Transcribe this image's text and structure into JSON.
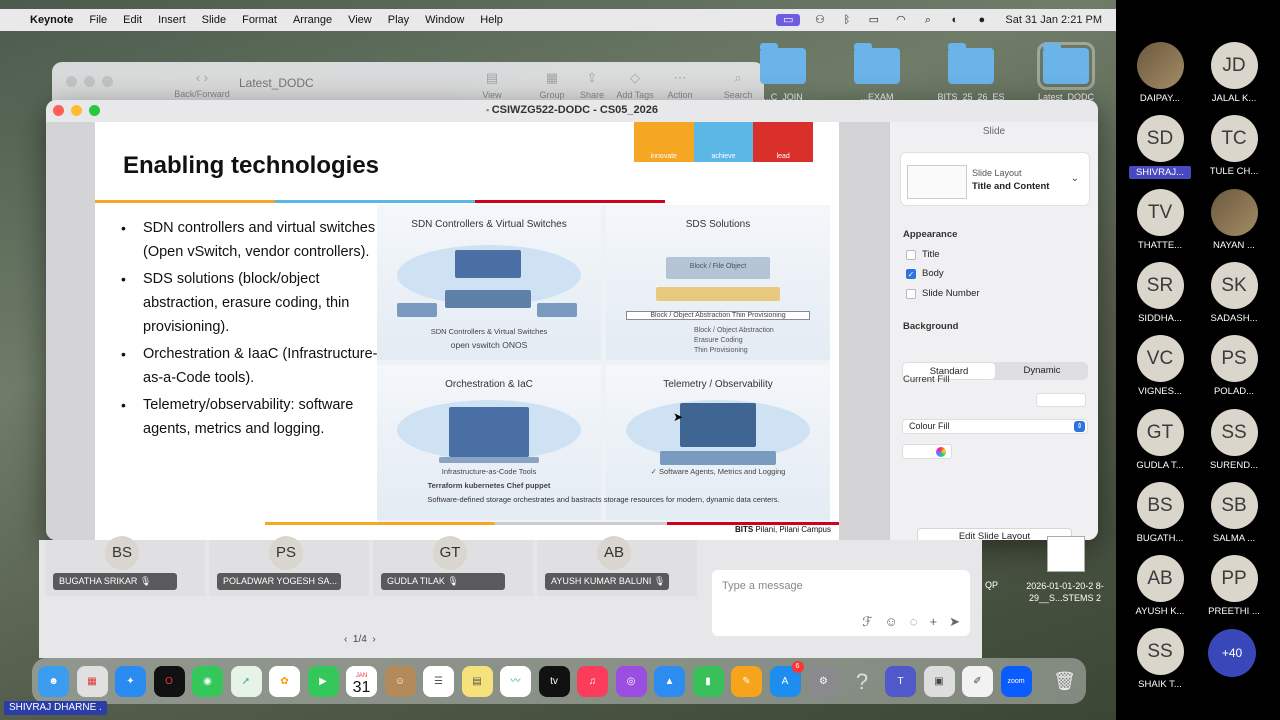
{
  "menubar": {
    "app": "Keynote",
    "items": [
      "File",
      "Edit",
      "Insert",
      "Slide",
      "Format",
      "Arrange",
      "View",
      "Play",
      "Window",
      "Help"
    ],
    "datetime": "Sat 31 Jan  2:21 PM"
  },
  "bg_finder": {
    "title": "Latest_DODC",
    "back_forward": "Back/Forward",
    "tools": [
      "View",
      "Group",
      "Share",
      "Add Tags",
      "Action",
      "Search"
    ]
  },
  "desktop_folders": [
    {
      "label": "...C_JOIN"
    },
    {
      "label": "...EXAM"
    },
    {
      "label": "BITS_25_26_ES"
    },
    {
      "label": "Latest_DODC"
    }
  ],
  "keynote": {
    "window_title": "CSIWZG522-DODC - CS05_2026",
    "slide": {
      "title": "Enabling technologies",
      "brand": [
        "innovate",
        "achieve",
        "lead"
      ],
      "bullets": [
        "SDN controllers and virtual switches (Open vSwitch, vendor controllers).",
        "SDS solutions (block/object abstraction, erasure coding, thin provisioning).",
        "Orchestration & IaaC (Infrastructure-as-a-Code tools).",
        "Telemetry/observability: software agents, metrics and logging."
      ],
      "infographic": {
        "q1": {
          "title": "SDN Controllers & Virtual Switches",
          "caption": "SDN Controllers & Virtual Switches",
          "logos": "open vswitch  ONOS"
        },
        "q2": {
          "title": "SDS Solutions",
          "top": "Block / File  Object",
          "bar": "Block / Object Abstraction   Thin Provisioning",
          "items": [
            "Block / Object Abstraction",
            "Erasure Coding",
            "Thin Provisioning"
          ]
        },
        "q3": {
          "title": "Orchestration & IaC",
          "caption": "Infrastructure-as-Code Tools",
          "logos": "Terraform   kubernetes   Chef   puppet"
        },
        "q4": {
          "title": "Telemetry / Observability",
          "caption": "✓ Software Agents, Metrics and Logging"
        },
        "footer": "Software-defined storage orchestrates and bastracts storage resources for modern, dynamic data centers."
      },
      "campus_bold": "BITS",
      "campus_rest": " Pilani, Pilani Campus"
    },
    "inspector": {
      "tab": "Slide",
      "layout_label": "Slide Layout",
      "layout_name": "Title and Content",
      "appearance": "Appearance",
      "checks": [
        {
          "label": "Title",
          "checked": false
        },
        {
          "label": "Body",
          "checked": true
        },
        {
          "label": "Slide Number",
          "checked": false
        }
      ],
      "background": "Background",
      "seg": [
        "Standard",
        "Dynamic"
      ],
      "current_fill": "Current Fill",
      "fill_type": "Colour Fill",
      "edit_layout": "Edit Slide Layout"
    }
  },
  "zoom": {
    "tiles": [
      {
        "initials": "BS",
        "name": "BUGATHA SRIKAR"
      },
      {
        "initials": "PS",
        "name": "POLADWAR YOGESH SA..."
      },
      {
        "initials": "GT",
        "name": "GUDLA TILAK"
      },
      {
        "initials": "AB",
        "name": "AYUSH KUMAR BALUNI"
      }
    ],
    "pager": "1/4",
    "chat_placeholder": "Type a message"
  },
  "desktop_file": {
    "label": "2026-01-01-20-2 8-29__S...STEMS 2",
    "side": "QP"
  },
  "dock": {
    "calendar_month": "JAN",
    "calendar_day": "31",
    "appstore_badge": "6",
    "zoom_label": "zoom"
  },
  "sharer": "SHIVRAJ DHARNE .",
  "participants": [
    {
      "initials": "",
      "name": "DAIPAY...",
      "photo": true
    },
    {
      "initials": "JD",
      "name": "JALAL K..."
    },
    {
      "initials": "SD",
      "name": "SHIVRAJ...",
      "highlight": true
    },
    {
      "initials": "TC",
      "name": "TULE CH..."
    },
    {
      "initials": "TV",
      "name": "THATTE..."
    },
    {
      "initials": "",
      "name": "NAYAN ...",
      "photo": true
    },
    {
      "initials": "SR",
      "name": "SIDDHA..."
    },
    {
      "initials": "SK",
      "name": "SADASH..."
    },
    {
      "initials": "VC",
      "name": "VIGNES..."
    },
    {
      "initials": "PS",
      "name": "POLAD..."
    },
    {
      "initials": "GT",
      "name": "GUDLA T..."
    },
    {
      "initials": "SS",
      "name": "SUREND..."
    },
    {
      "initials": "BS",
      "name": "BUGATH..."
    },
    {
      "initials": "SB",
      "name": "SALMA ..."
    },
    {
      "initials": "AB",
      "name": "AYUSH K..."
    },
    {
      "initials": "PP",
      "name": "PREETHI ..."
    },
    {
      "initials": "SS",
      "name": "SHAIK T..."
    }
  ],
  "more_count": "+40"
}
